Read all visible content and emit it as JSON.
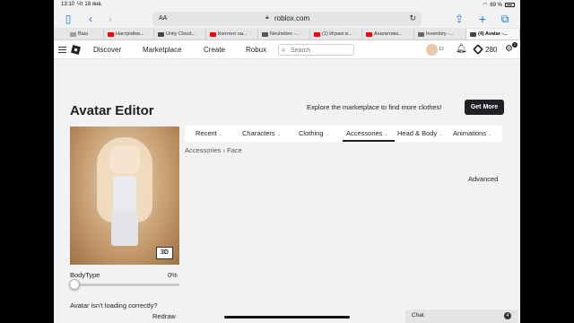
{
  "status_bar": {
    "time": "13:10",
    "date": "Чт 18 янв.",
    "battery": "69 %"
  },
  "browser": {
    "text_size": "AA",
    "url": "roblox.com",
    "tabs": [
      {
        "label": "Ваш",
        "color": "#9e9e9e"
      },
      {
        "label": "Настройки...",
        "color": "#ff0000"
      },
      {
        "label": "Unity Cloud...",
        "color": "#444444"
      },
      {
        "label": "Контент на...",
        "color": "#ff0000"
      },
      {
        "label": "Neuheiten -...",
        "color": "#555555"
      },
      {
        "label": "(1) Играю в...",
        "color": "#ff0000"
      },
      {
        "label": "Аналитика...",
        "color": "#ff0000"
      },
      {
        "label": "Inventory -...",
        "color": "#666666"
      },
      {
        "label": "(4) Avatar -...",
        "color": "#444444"
      }
    ]
  },
  "nav": {
    "links": [
      "Discover",
      "Marketplace",
      "Create",
      "Robux"
    ],
    "search_placeholder": "Search",
    "friend_badge": "13",
    "robux": "280",
    "notif_count": "1"
  },
  "page": {
    "title": "Avatar Editor",
    "explore_text": "Explore the marketplace to find more clothes!",
    "get_more": "Get More",
    "btn_3d": "3D",
    "body_type_label": "BodyType",
    "body_type_value": "0%",
    "body_type_level": 0,
    "not_loading": "Avatar isn't loading correctly?",
    "redraw": "Redraw",
    "categories": [
      "Recent",
      "Characters",
      "Clothing",
      "Accessories",
      "Head & Body",
      "Animations"
    ],
    "active_category": "Accessories",
    "breadcrumb": {
      "parent": "Accessories",
      "separator": "›",
      "current": "Face"
    },
    "advanced": "Advanced"
  },
  "chat": {
    "label": "Chat",
    "badge": "4"
  }
}
